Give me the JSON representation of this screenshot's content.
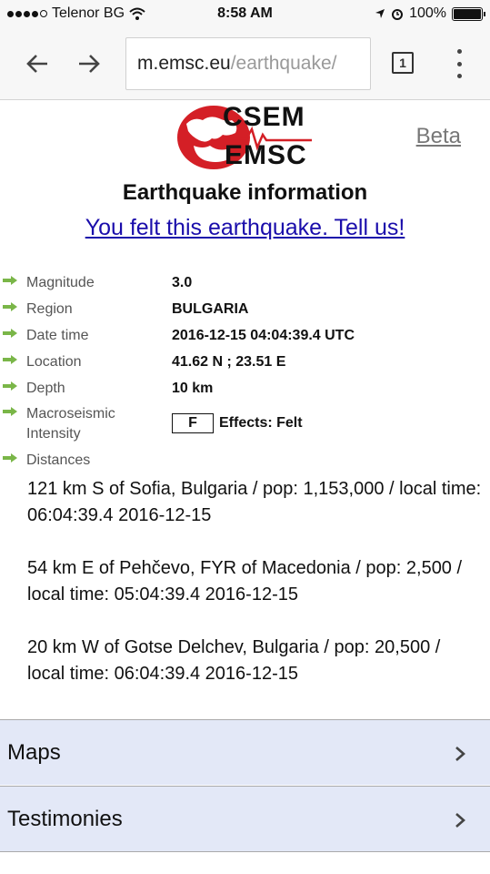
{
  "status_bar": {
    "carrier": "Telenor BG",
    "time": "8:58 AM",
    "battery": "100%"
  },
  "browser": {
    "url_host": "m.emsc.eu",
    "url_path": "/earthquake/",
    "tab_count": "1"
  },
  "header": {
    "logo_top": "CSEM",
    "logo_bottom": "EMSC",
    "beta_label": "Beta",
    "title": "Earthquake information",
    "felt_link": "You felt this earthquake. Tell us!"
  },
  "info": {
    "magnitude_label": "Magnitude",
    "magnitude": "3.0",
    "region_label": "Region",
    "region": "BULGARIA",
    "datetime_label": "Date time",
    "datetime": "2016-12-15 04:04:39.4 UTC",
    "location_label": "Location",
    "location": "41.62 N ; 23.51 E",
    "depth_label": "Depth",
    "depth": "10 km",
    "intensity_label_line1": "Macroseismic",
    "intensity_label_line2": "Intensity",
    "intensity_code": "F",
    "intensity_text": "Effects: Felt",
    "distances_label": "Distances"
  },
  "distances": [
    "121 km S of Sofia, Bulgaria / pop: 1,153,000 / local time: 06:04:39.4 2016-12-15",
    "54 km E of Pehčevo, FYR of Macedonia / pop: 2,500 / local time: 05:04:39.4 2016-12-15",
    "20 km W of Gotse Delchev, Bulgaria / pop: 20,500 / local time: 06:04:39.4 2016-12-15"
  ],
  "menu": {
    "maps": "Maps",
    "testimonies": "Testimonies"
  },
  "colors": {
    "link": "#1a0dab",
    "logo_red": "#d41f26",
    "arrow_green": "#7ab648",
    "menu_bg": "#e3e8f7"
  }
}
